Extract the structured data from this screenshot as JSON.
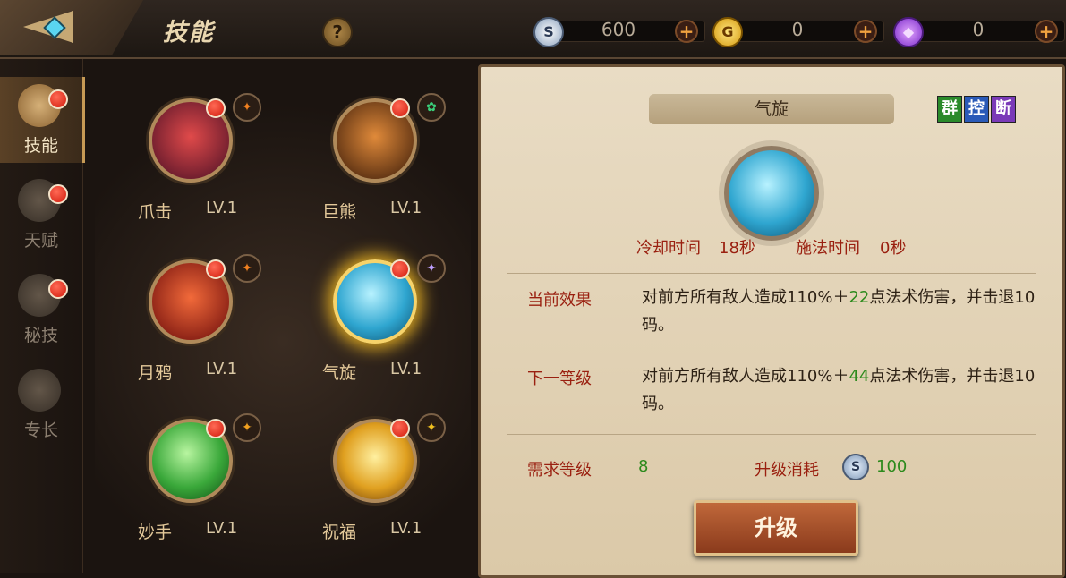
{
  "header": {
    "title": "技能",
    "help_label": "?",
    "currencies": [
      {
        "icon": "silver-coin-icon",
        "symbol": "S",
        "value": "600",
        "plus": "+",
        "color": "#c9d6e8"
      },
      {
        "icon": "gold-coin-icon",
        "symbol": "G",
        "value": "0",
        "plus": "+",
        "color": "#f0c025"
      },
      {
        "icon": "crystal-icon",
        "symbol": "◆",
        "value": "0",
        "plus": "+",
        "color": "#9a4fe0"
      }
    ]
  },
  "nav": {
    "items": [
      {
        "label": "技能",
        "active": true
      },
      {
        "label": "天赋",
        "active": false
      },
      {
        "label": "秘技",
        "active": false
      },
      {
        "label": "专长",
        "active": false
      }
    ]
  },
  "skills": [
    {
      "name": "爪击",
      "level": "LV.1",
      "color": "#b02436",
      "tag_icon": "fire-claw-icon",
      "tag": "✦"
    },
    {
      "name": "巨熊",
      "level": "LV.1",
      "color": "#8a4a1c",
      "tag_icon": "paw-icon",
      "tag": "✿"
    },
    {
      "name": "月鸦",
      "level": "LV.1",
      "color": "#c82a1a",
      "tag_icon": "flame-icon",
      "tag": "✦"
    },
    {
      "name": "气旋",
      "level": "LV.1",
      "color": "#2fa6d0",
      "tag_icon": "storm-icon",
      "tag": "✦"
    },
    {
      "name": "妙手",
      "level": "LV.1",
      "color": "#3aa83a",
      "tag_icon": "swirl-icon",
      "tag": "✦"
    },
    {
      "name": "祝福",
      "level": "LV.1",
      "color": "#e0a020",
      "tag_icon": "burst-icon",
      "tag": "✦"
    }
  ],
  "detail": {
    "name": "气旋",
    "tags": [
      {
        "text": "群",
        "color": "#2a8a2a"
      },
      {
        "text": "控",
        "color": "#2a5ab8"
      },
      {
        "text": "断",
        "color": "#7a3ab8"
      }
    ],
    "cooldown_label": "冷却时间",
    "cooldown_value": "18秒",
    "cast_label": "施法时间",
    "cast_value": "0秒",
    "current_label": "当前效果",
    "current_desc_a": "对前方所有敌人造成110%＋",
    "current_desc_num": "22",
    "current_desc_b": "点法术伤害，并击退10码。",
    "next_label": "下一等级",
    "next_desc_a": "对前方所有敌人造成110%＋",
    "next_desc_num": "44",
    "next_desc_b": "点法术伤害，并击退10码。",
    "req_label": "需求等级",
    "req_value": "8",
    "cost_label": "升级消耗",
    "cost_symbol": "S",
    "cost_value": "100",
    "upgrade_label": "升级"
  }
}
